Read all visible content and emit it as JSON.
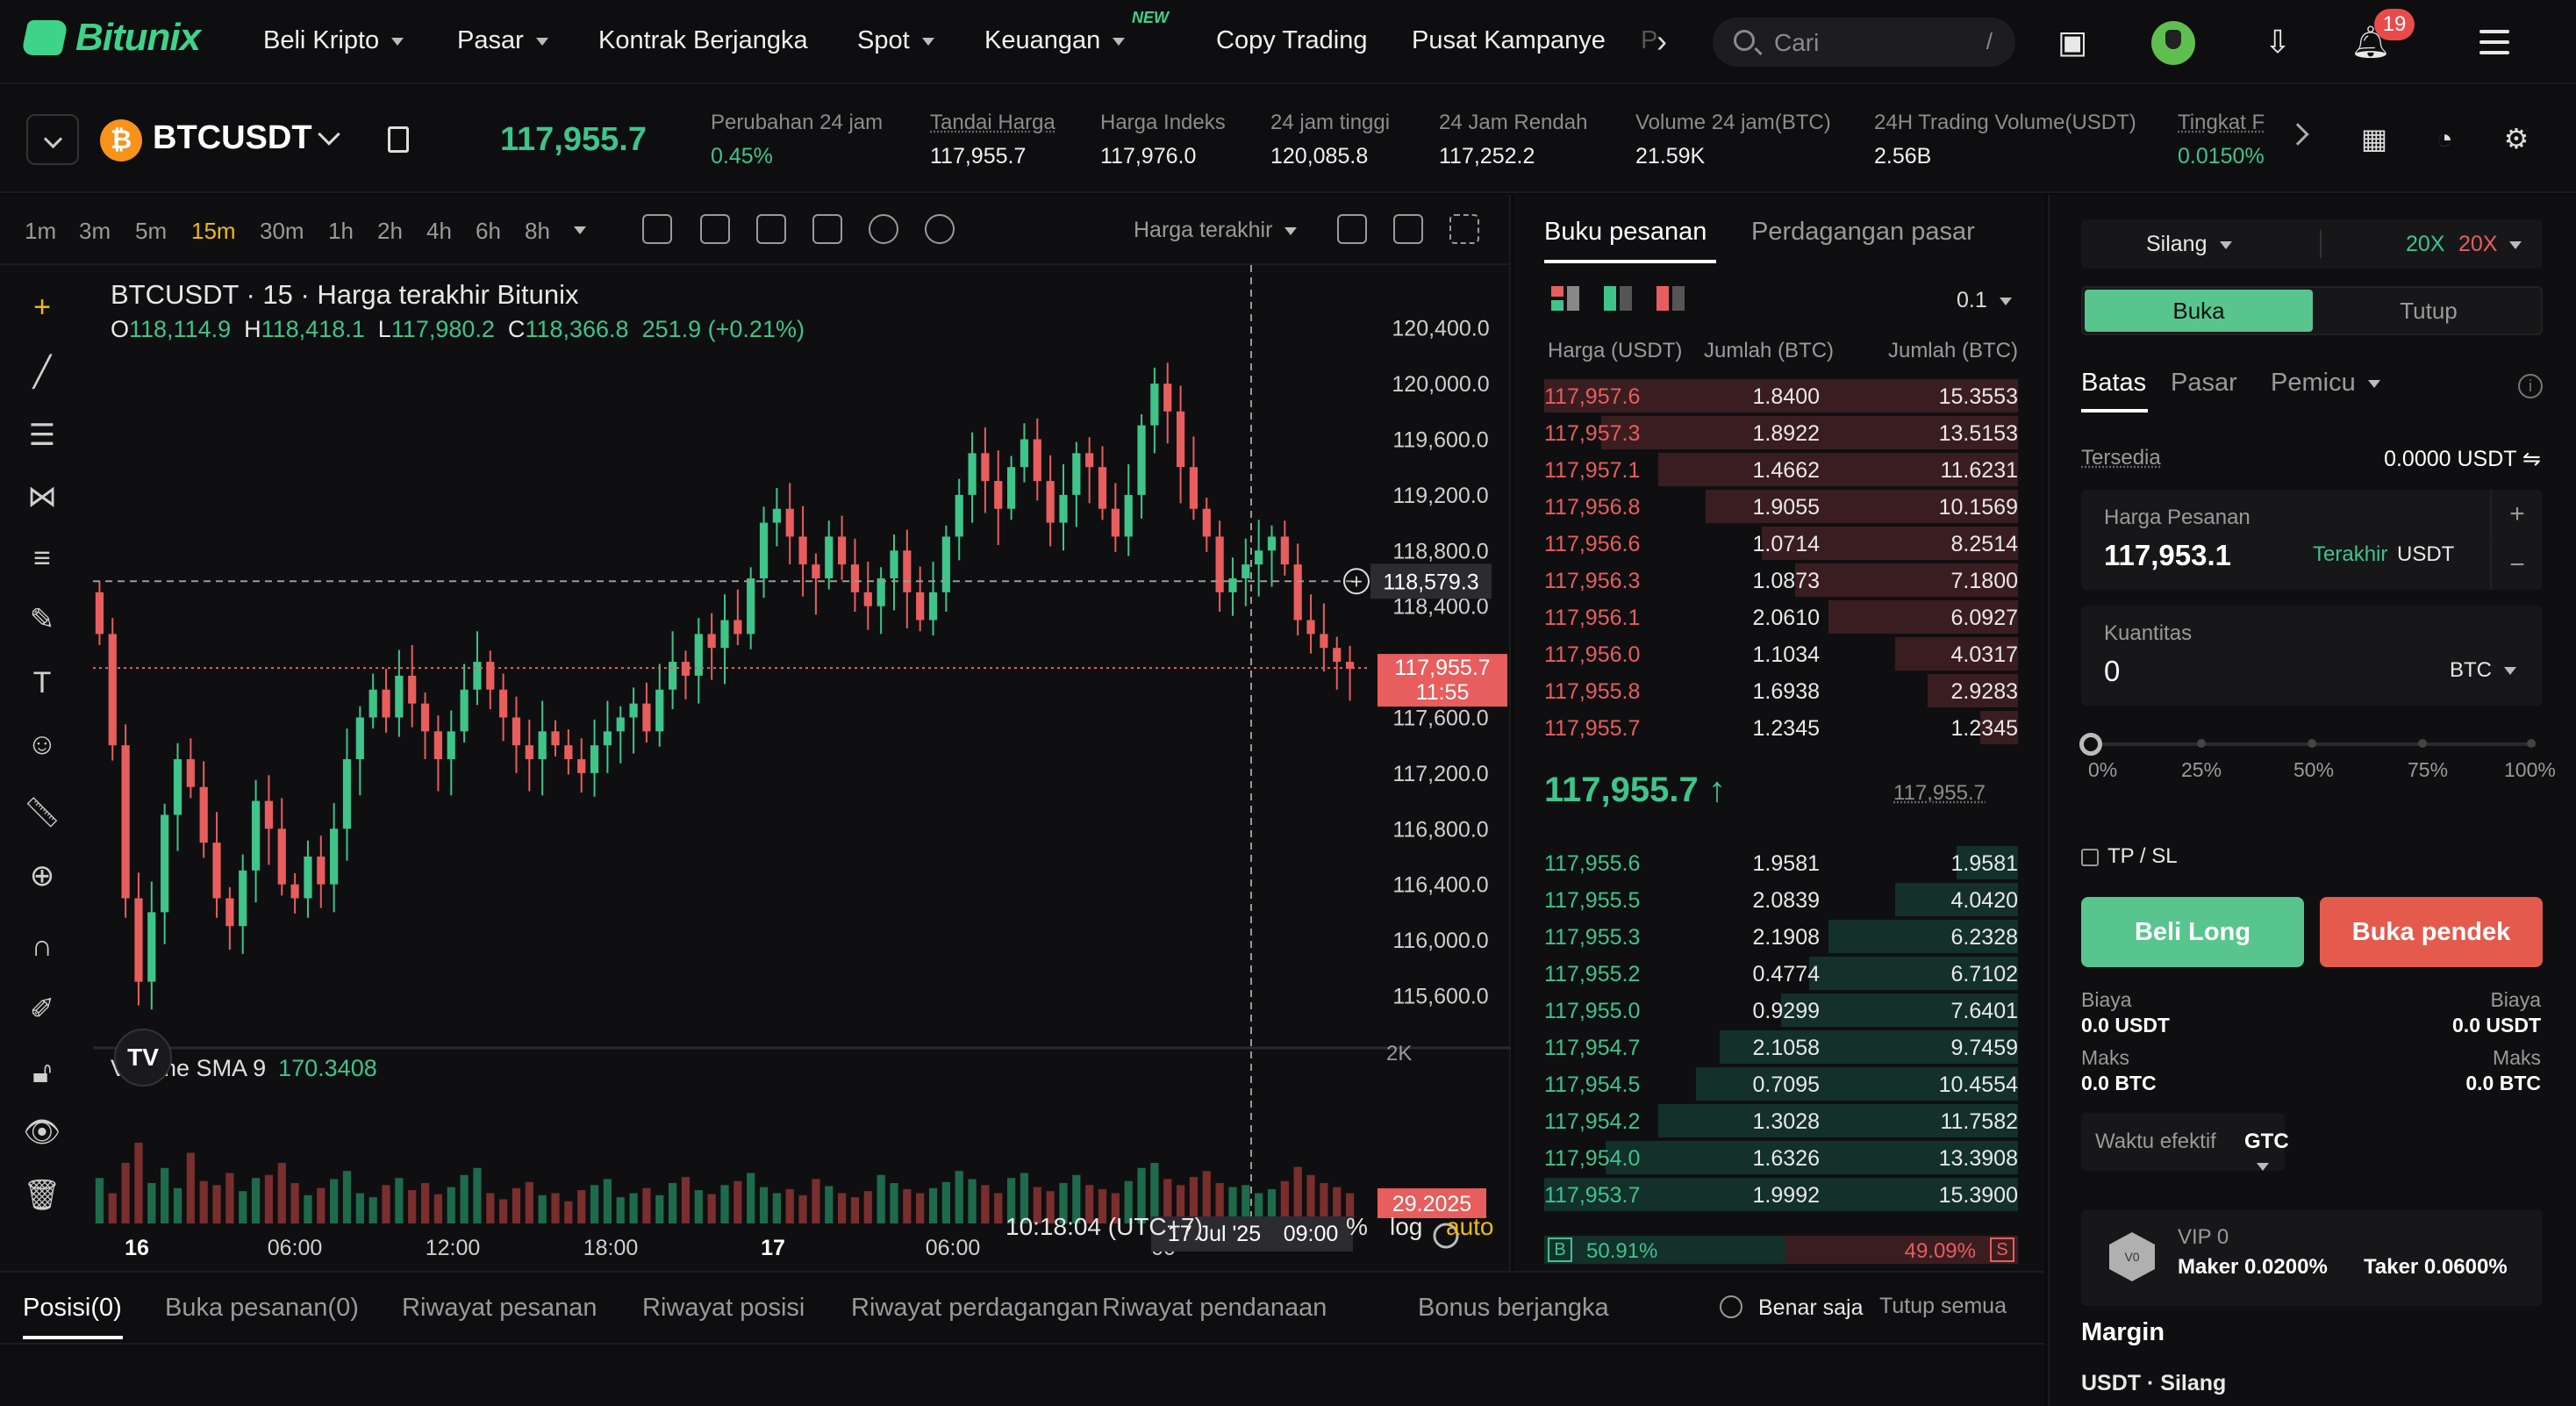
{
  "brand": "Bitunix",
  "nav": {
    "items": [
      "Beli Kripto",
      "Pasar",
      "Kontrak Berjangka",
      "Spot",
      "Keuangan",
      "Copy Trading",
      "Pusat Kampanye"
    ],
    "overflow_fade": "P",
    "new_badge": "NEW"
  },
  "search": {
    "placeholder": "Cari",
    "shortcut": "/"
  },
  "notifications_count": "19",
  "ticker": {
    "symbol": "BTCUSDT",
    "last_price": "117,955.7",
    "stats": [
      {
        "label": "Perubahan 24 jam",
        "value": "0.45%"
      },
      {
        "label": "Tandai Harga",
        "value": "117,955.7"
      },
      {
        "label": "Harga Indeks",
        "value": "117,976.0"
      },
      {
        "label": "24 jam tinggi",
        "value": "120,085.8"
      },
      {
        "label": "24 Jam Rendah",
        "value": "117,252.2"
      },
      {
        "label": "Volume 24 jam(BTC)",
        "value": "21.59K"
      },
      {
        "label": "24H Trading Volume(USDT)",
        "value": "2.56B"
      },
      {
        "label": "Tingkat F",
        "value": "0.0150%"
      }
    ]
  },
  "chart": {
    "intervals": [
      "1m",
      "3m",
      "5m",
      "15m",
      "30m",
      "1h",
      "2h",
      "4h",
      "6h",
      "8h"
    ],
    "active_interval": "15m",
    "price_source": "Harga terakhir",
    "title": "BTCUSDT · 15 · Harga terakhir Bitunix",
    "ohlc": {
      "o": "118,114.9",
      "h": "118,418.1",
      "l": "117,980.2",
      "c": "118,366.8",
      "chg": "251.9 (+0.21%)"
    },
    "volume_label": "Volume SMA 9",
    "volume_value": "170.3408",
    "clock": "10:18:04 (UTC+7)",
    "options": [
      "%",
      "log",
      "auto"
    ],
    "crosshair_date": "17 Jul '25",
    "crosshair_time": "09:00",
    "crosshair_price": "118,579.3",
    "last_tag_price": "117,955.7",
    "last_tag_countdown": "11:55",
    "volume_tag": "29.2025",
    "volume_axis_label": "2K"
  },
  "chart_data": {
    "type": "candlestick",
    "title": "BTCUSDT · 15 · Harga terakhir Bitunix",
    "y_ticks": [
      "120,400.0",
      "120,000.0",
      "119,600.0",
      "119,200.0",
      "118,800.0",
      "118,400.0",
      "118,000.0",
      "117,600.0",
      "117,200.0",
      "116,800.0",
      "116,400.0",
      "116,000.0",
      "115,600.0"
    ],
    "x_ticks": [
      "16",
      "06:00",
      "12:00",
      "18:00",
      "17",
      "06:00",
      "00"
    ],
    "ylim": [
      115300,
      120600
    ],
    "close_series": [
      118200,
      117400,
      116300,
      115700,
      116200,
      116900,
      117300,
      117100,
      116700,
      116300,
      116100,
      116500,
      117000,
      116800,
      116400,
      116300,
      116600,
      116400,
      116800,
      117300,
      117600,
      117800,
      117600,
      117900,
      117700,
      117500,
      117300,
      117500,
      117800,
      118000,
      117800,
      117600,
      117400,
      117300,
      117500,
      117400,
      117300,
      117200,
      117400,
      117500,
      117600,
      117700,
      117500,
      117800,
      118000,
      117900,
      118200,
      118100,
      118300,
      118200,
      118600,
      119000,
      119100,
      118900,
      118700,
      118600,
      118900,
      118700,
      118500,
      118400,
      118600,
      118800,
      118500,
      118300,
      118500,
      118900,
      119200,
      119500,
      119300,
      119100,
      119400,
      119600,
      119300,
      119000,
      119200,
      119500,
      119400,
      119100,
      118900,
      119200,
      119700,
      120000,
      119800,
      119400,
      119100,
      118900,
      118500,
      118600,
      118700,
      118800,
      118900,
      118700,
      118300,
      118200,
      118100,
      118000,
      117950
    ],
    "volume_series": [
      45,
      30,
      60,
      80,
      40,
      55,
      35,
      70,
      42,
      38,
      50,
      32,
      45,
      48,
      60,
      40,
      28,
      35,
      44,
      52,
      30,
      26,
      38,
      45,
      33,
      40,
      29,
      36,
      48,
      55,
      30,
      24,
      35,
      41,
      28,
      30,
      22,
      33,
      38,
      44,
      26,
      30,
      35,
      28,
      40,
      46,
      33,
      29,
      38,
      42,
      50,
      36,
      30,
      34,
      28,
      44,
      37,
      30,
      26,
      32,
      48,
      40,
      34,
      30,
      35,
      41,
      52,
      44,
      38,
      30,
      45,
      50,
      36,
      32,
      40,
      48,
      38,
      34,
      30,
      42,
      55,
      60,
      44,
      38,
      46,
      52,
      40,
      36,
      38,
      30,
      34,
      42,
      56,
      48,
      40,
      36,
      30
    ]
  },
  "orderbook": {
    "tabs": [
      "Buku pesanan",
      "Perdagangan pasar"
    ],
    "precision": "0.1",
    "headers": [
      "Harga (USDT)",
      "Jumlah (BTC)",
      "Jumlah (BTC)"
    ],
    "asks": [
      {
        "p": "117,957.6",
        "q": "1.8400",
        "t": "15.3553",
        "d": 1.0
      },
      {
        "p": "117,957.3",
        "q": "1.8922",
        "t": "13.5153",
        "d": 0.88
      },
      {
        "p": "117,957.1",
        "q": "1.4662",
        "t": "11.6231",
        "d": 0.76
      },
      {
        "p": "117,956.8",
        "q": "1.9055",
        "t": "10.1569",
        "d": 0.66
      },
      {
        "p": "117,956.6",
        "q": "1.0714",
        "t": "8.2514",
        "d": 0.54
      },
      {
        "p": "117,956.3",
        "q": "1.0873",
        "t": "7.1800",
        "d": 0.47
      },
      {
        "p": "117,956.1",
        "q": "2.0610",
        "t": "6.0927",
        "d": 0.4
      },
      {
        "p": "117,956.0",
        "q": "1.1034",
        "t": "4.0317",
        "d": 0.26
      },
      {
        "p": "117,955.8",
        "q": "1.6938",
        "t": "2.9283",
        "d": 0.19
      },
      {
        "p": "117,955.7",
        "q": "1.2345",
        "t": "1.2345",
        "d": 0.08
      }
    ],
    "mid_price": "117,955.7",
    "mid_mark": "117,955.7",
    "bids": [
      {
        "p": "117,955.6",
        "q": "1.9581",
        "t": "1.9581",
        "d": 0.13
      },
      {
        "p": "117,955.5",
        "q": "2.0839",
        "t": "4.0420",
        "d": 0.26
      },
      {
        "p": "117,955.3",
        "q": "2.1908",
        "t": "6.2328",
        "d": 0.4
      },
      {
        "p": "117,955.2",
        "q": "0.4774",
        "t": "6.7102",
        "d": 0.44
      },
      {
        "p": "117,955.0",
        "q": "0.9299",
        "t": "7.6401",
        "d": 0.5
      },
      {
        "p": "117,954.7",
        "q": "2.1058",
        "t": "9.7459",
        "d": 0.63
      },
      {
        "p": "117,954.5",
        "q": "0.7095",
        "t": "10.4554",
        "d": 0.68
      },
      {
        "p": "117,954.2",
        "q": "1.3028",
        "t": "11.7582",
        "d": 0.76
      },
      {
        "p": "117,954.0",
        "q": "1.6326",
        "t": "13.3908",
        "d": 0.87
      },
      {
        "p": "117,953.7",
        "q": "1.9992",
        "t": "15.3900",
        "d": 1.0
      }
    ],
    "buy_ratio": "50.91%",
    "sell_ratio": "49.09%",
    "buy_tag": "B",
    "sell_tag": "S"
  },
  "order_form": {
    "margin_mode": "Silang",
    "leverage_long": "20X",
    "leverage_short": "20X",
    "open_label": "Buka",
    "close_label": "Tutup",
    "order_types": [
      "Batas",
      "Pasar",
      "Pemicu"
    ],
    "available_label": "Tersedia",
    "available_value": "0.0000 USDT",
    "price_label": "Harga Pesanan",
    "price_value": "117,953.1",
    "price_last": "Terakhir",
    "price_unit": "USDT",
    "qty_label": "Kuantitas",
    "qty_value": "0",
    "qty_unit": "BTC",
    "slider_marks": [
      "0%",
      "25%",
      "50%",
      "75%",
      "100%"
    ],
    "slider_value": 0,
    "tpsl": "TP / SL",
    "long_button": "Beli Long",
    "short_button": "Buka pendek",
    "cost_label": "Biaya",
    "cost_long": "0.0 USDT",
    "cost_short": "0.0 USDT",
    "max_label": "Maks",
    "max_long": "0.0 BTC",
    "max_short": "0.0 BTC",
    "tif_label": "Waktu efektif",
    "tif_value": "GTC",
    "vip_level": "VIP 0",
    "vip_badge": "V0",
    "maker_fee": "Maker 0.0200%",
    "taker_fee": "Taker 0.0600%",
    "margin_title": "Margin",
    "margin_sub": "USDT · Silang"
  },
  "bottom_tabs": [
    "Posisi(0)",
    "Buka pesanan(0)",
    "Riwayat pesanan",
    "Riwayat posisi",
    "Riwayat perdagangan",
    "Riwayat pendanaan",
    "Bonus berjangka"
  ],
  "only_label": "Benar saja",
  "close_all": "Tutup semua",
  "colors": {
    "up": "#3fc48a",
    "down": "#e85d5d",
    "accent": "#f0b90b",
    "brand": "#3fd38a"
  }
}
